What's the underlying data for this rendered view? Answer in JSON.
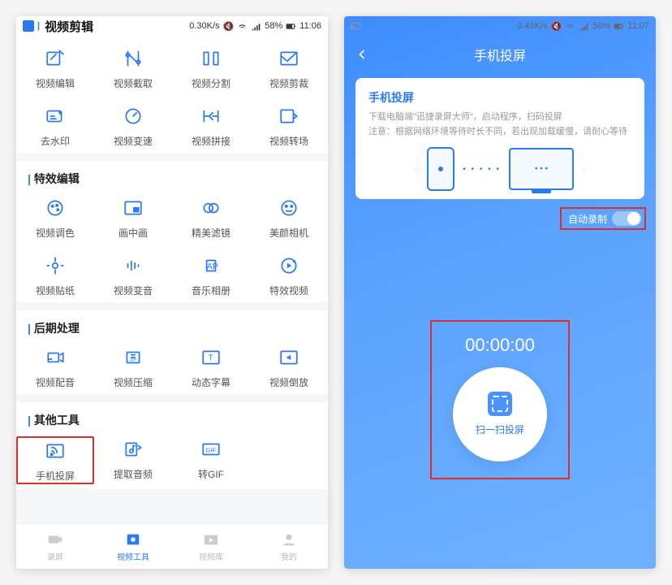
{
  "phone1": {
    "status": {
      "speed": "0.30K/s",
      "battery": "58%",
      "time": "11:06"
    },
    "title": "视频剪辑",
    "sections": [
      {
        "title": "",
        "items": [
          {
            "label": "视频编辑",
            "icon": "edit"
          },
          {
            "label": "视频截取",
            "icon": "trim"
          },
          {
            "label": "视频分割",
            "icon": "split"
          },
          {
            "label": "视频剪裁",
            "icon": "crop"
          },
          {
            "label": "去水印",
            "icon": "watermark"
          },
          {
            "label": "视频变速",
            "icon": "speed"
          },
          {
            "label": "视频拼接",
            "icon": "merge"
          },
          {
            "label": "视频转场",
            "icon": "transition"
          }
        ]
      },
      {
        "title": "特效编辑",
        "items": [
          {
            "label": "视频调色",
            "icon": "palette"
          },
          {
            "label": "画中画",
            "icon": "pip"
          },
          {
            "label": "精美滤镜",
            "icon": "filter"
          },
          {
            "label": "美颜相机",
            "icon": "beauty"
          },
          {
            "label": "视频贴纸",
            "icon": "sticker"
          },
          {
            "label": "视频变音",
            "icon": "audio"
          },
          {
            "label": "音乐相册",
            "icon": "music"
          },
          {
            "label": "特效视频",
            "icon": "fx"
          }
        ]
      },
      {
        "title": "后期处理",
        "items": [
          {
            "label": "视频配音",
            "icon": "dub"
          },
          {
            "label": "视频压缩",
            "icon": "compress"
          },
          {
            "label": "动态字幕",
            "icon": "subtitle"
          },
          {
            "label": "视频倒放",
            "icon": "reverse"
          }
        ]
      },
      {
        "title": "其他工具",
        "items": [
          {
            "label": "手机投屏",
            "icon": "cast",
            "highlight": true
          },
          {
            "label": "提取音频",
            "icon": "extract"
          },
          {
            "label": "转GIF",
            "icon": "gif"
          }
        ]
      }
    ],
    "tabs": [
      {
        "label": "录屏",
        "icon": "record",
        "active": false
      },
      {
        "label": "视频工具",
        "icon": "tools",
        "active": true
      },
      {
        "label": "视频库",
        "icon": "library",
        "active": false
      },
      {
        "label": "我的",
        "icon": "profile",
        "active": false
      }
    ]
  },
  "phone2": {
    "status": {
      "speed": "0.45K/s",
      "battery": "58%",
      "time": "11:07"
    },
    "title": "手机投屏",
    "card": {
      "title": "手机投屏",
      "line1": "下载电脑端\"迅捷录屏大师\"，启动程序，扫码投屏",
      "line2": "注意：根据网络环境等待时长不同，若出现加载缓慢，请耐心等待"
    },
    "toggle_label": "自动录制",
    "timer": "00:00:00",
    "scan_label": "扫一扫投屏"
  }
}
